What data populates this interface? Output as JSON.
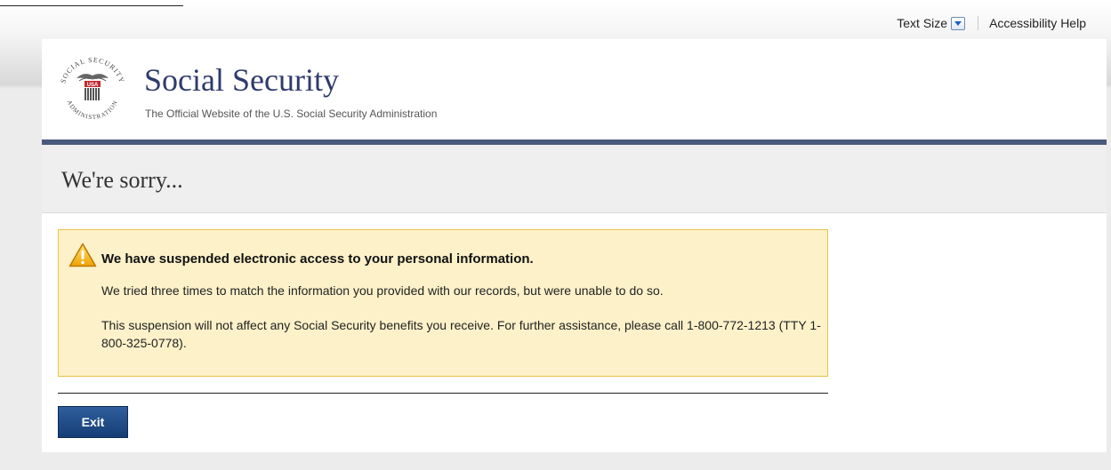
{
  "utility": {
    "text_size_label": "Text Size",
    "accessibility_help": "Accessibility Help"
  },
  "header": {
    "title": "Social Security",
    "subtitle": "The Official Website of the U.S. Social Security Administration",
    "seal_text_top": "SOCIAL SECURITY",
    "seal_text_bottom": "ADMINISTRATION",
    "seal_center": "USA"
  },
  "page": {
    "heading": "We're sorry..."
  },
  "alert": {
    "icon": "warning-icon",
    "heading": "We have suspended electronic access to your personal information.",
    "paragraph1": "We tried three times to match the information you provided with our records, but were unable to do so.",
    "paragraph2": "This suspension will not affect any Social Security benefits you receive. For further assistance, please call 1-800-772-1213 (TTY 1-800-325-0778)."
  },
  "actions": {
    "exit_label": "Exit"
  },
  "colors": {
    "brand": "#2e3b6b",
    "header_rule": "#4a5a7c",
    "alert_bg": "#fcf1c9",
    "alert_border": "#e8c04a",
    "button": "#153e75"
  }
}
